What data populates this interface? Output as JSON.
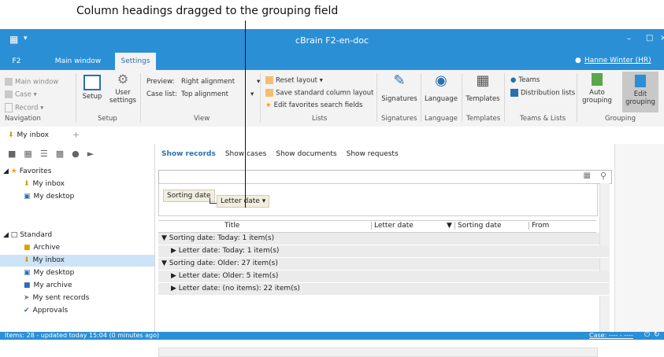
{
  "annotation": {
    "text": "Column headings dragged to the grouping field"
  },
  "window": {
    "title": "cBrain F2-en-doc",
    "app_icon": "app-icon"
  },
  "tabs": [
    {
      "label": "F2"
    },
    {
      "label": "Main window"
    },
    {
      "label": "Settings"
    }
  ],
  "user": {
    "name": "Hanne Winter (HR)"
  },
  "ribbon": {
    "navigation": {
      "items": [
        "Main window",
        "Case",
        "Record"
      ],
      "label": "Navigation"
    },
    "setup": {
      "setup_label": "Setup",
      "user_settings_label": "User settings",
      "label": "Setup"
    },
    "view": {
      "preview_label": "Preview:",
      "preview_value": "Right alignment",
      "caselist_label": "Case list:",
      "caselist_value": "Top alignment",
      "label": "View"
    },
    "lists": {
      "reset_layout": "Reset layout",
      "save_layout": "Save standard column layout",
      "edit_favorites": "Edit favorites search fields",
      "label": "Lists"
    },
    "signatures": {
      "button": "Signatures",
      "label": "Signatures"
    },
    "language": {
      "button": "Language",
      "label": "Language"
    },
    "templates": {
      "button": "Templates",
      "label": "Templates"
    },
    "teams": {
      "teams": "Teams",
      "distribution": "Distribution lists",
      "label": "Teams & Lists"
    },
    "grouping": {
      "auto": "Auto grouping",
      "edit": "Edit grouping",
      "label": "Grouping"
    }
  },
  "doctab": {
    "label": "My inbox",
    "add": "+"
  },
  "tree": {
    "favorites": {
      "label": "Favorites",
      "items": [
        "My inbox",
        "My desktop"
      ]
    },
    "standard": {
      "label": "Standard",
      "items": [
        "Archive",
        "My inbox",
        "My desktop",
        "My archive",
        "My sent records",
        "Approvals"
      ]
    }
  },
  "main": {
    "show": [
      "Show records",
      "Show cases",
      "Show documents",
      "Show requests"
    ],
    "group_chips": [
      "Sorting date",
      "Letter date"
    ],
    "columns": [
      "Title",
      "Letter date",
      "Sorting date",
      "From"
    ],
    "rows": [
      {
        "text": "Sorting date: Today: 1 item(s)",
        "level": 0,
        "expanded": true
      },
      {
        "text": "Letter date: Today: 1 item(s)",
        "level": 1,
        "expanded": false
      },
      {
        "text": "Sorting date: Older: 27 item(s)",
        "level": 0,
        "expanded": true
      },
      {
        "text": "Letter date: Older: 5 item(s)",
        "level": 1,
        "expanded": false
      },
      {
        "text": "Letter date: (no items): 22 item(s)",
        "level": 1,
        "expanded": false
      }
    ]
  },
  "status": {
    "left": "Items: 28 - updated today 15:04 (0 minutes ago)",
    "right": "Case: ---- - ----"
  },
  "colors": {
    "accent": "#2b8fd6",
    "selection": "#cde3f7"
  }
}
